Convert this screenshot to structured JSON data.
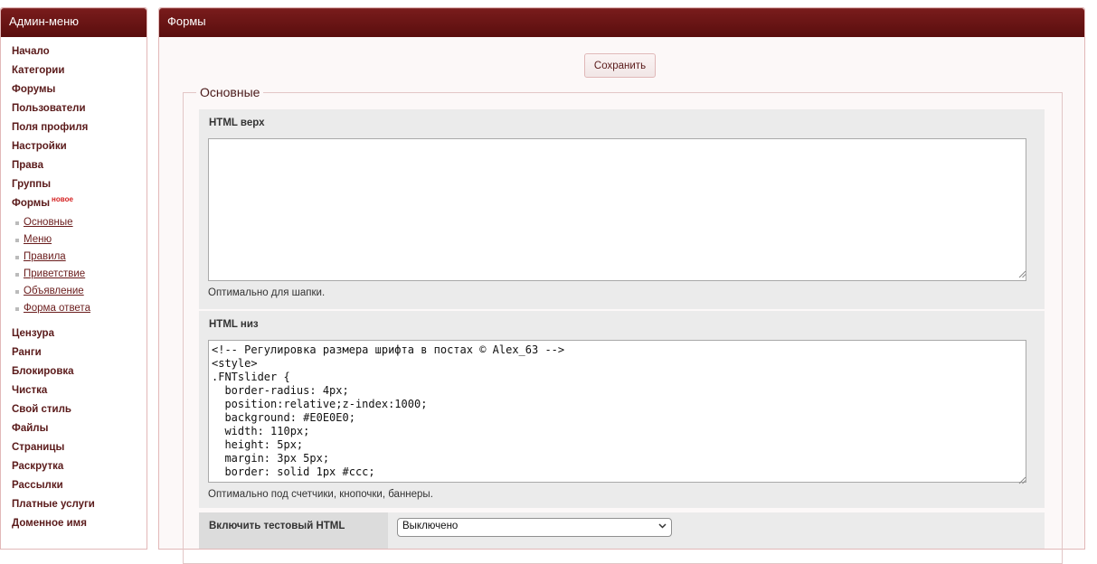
{
  "sidebar": {
    "title": "Админ-меню",
    "items_top": [
      {
        "label": "Начало"
      },
      {
        "label": "Категории"
      },
      {
        "label": "Форумы"
      },
      {
        "label": "Пользователи"
      },
      {
        "label": "Поля профиля"
      },
      {
        "label": "Настройки"
      },
      {
        "label": "Права"
      },
      {
        "label": "Группы"
      }
    ],
    "forms_item": {
      "label": "Формы",
      "badge": "новое"
    },
    "sub_items": [
      {
        "label": "Основные"
      },
      {
        "label": "Меню"
      },
      {
        "label": "Правила"
      },
      {
        "label": "Приветствие"
      },
      {
        "label": "Объявление"
      },
      {
        "label": "Форма ответа"
      }
    ],
    "items_bottom": [
      {
        "label": "Цензура"
      },
      {
        "label": "Ранги"
      },
      {
        "label": "Блокировка"
      },
      {
        "label": "Чистка"
      },
      {
        "label": "Свой стиль"
      },
      {
        "label": "Файлы"
      },
      {
        "label": "Страницы"
      },
      {
        "label": "Раскрутка"
      },
      {
        "label": "Рассылки"
      },
      {
        "label": "Платные услуги"
      },
      {
        "label": "Доменное имя"
      }
    ]
  },
  "main": {
    "title": "Формы",
    "save_label": "Сохранить",
    "section_legend": "Основные",
    "html_top": {
      "label": "HTML верх",
      "value": "",
      "hint": "Оптимально для шапки."
    },
    "html_bottom": {
      "label": "HTML низ",
      "value": "<!-- Регулировка размера шрифта в постах © Alex_63 -->\n<style>\n.FNTslider {\n  border-radius: 4px;\n  position:relative;z-index:1000;\n  background: #E0E0E0;\n  width: 110px;\n  height: 5px;\n  margin: 3px 5px;\n  border: solid 1px #ccc;",
      "hint": "Оптимально под счетчики, кнопочки, баннеры."
    },
    "test_html": {
      "label": "Включить тестовый HTML",
      "selected": "Выключено"
    }
  },
  "colors": {
    "header": "#6b1414",
    "accent_text": "#5a1a1a",
    "badge": "#d42020",
    "panel_border": "#e2b8b8"
  }
}
